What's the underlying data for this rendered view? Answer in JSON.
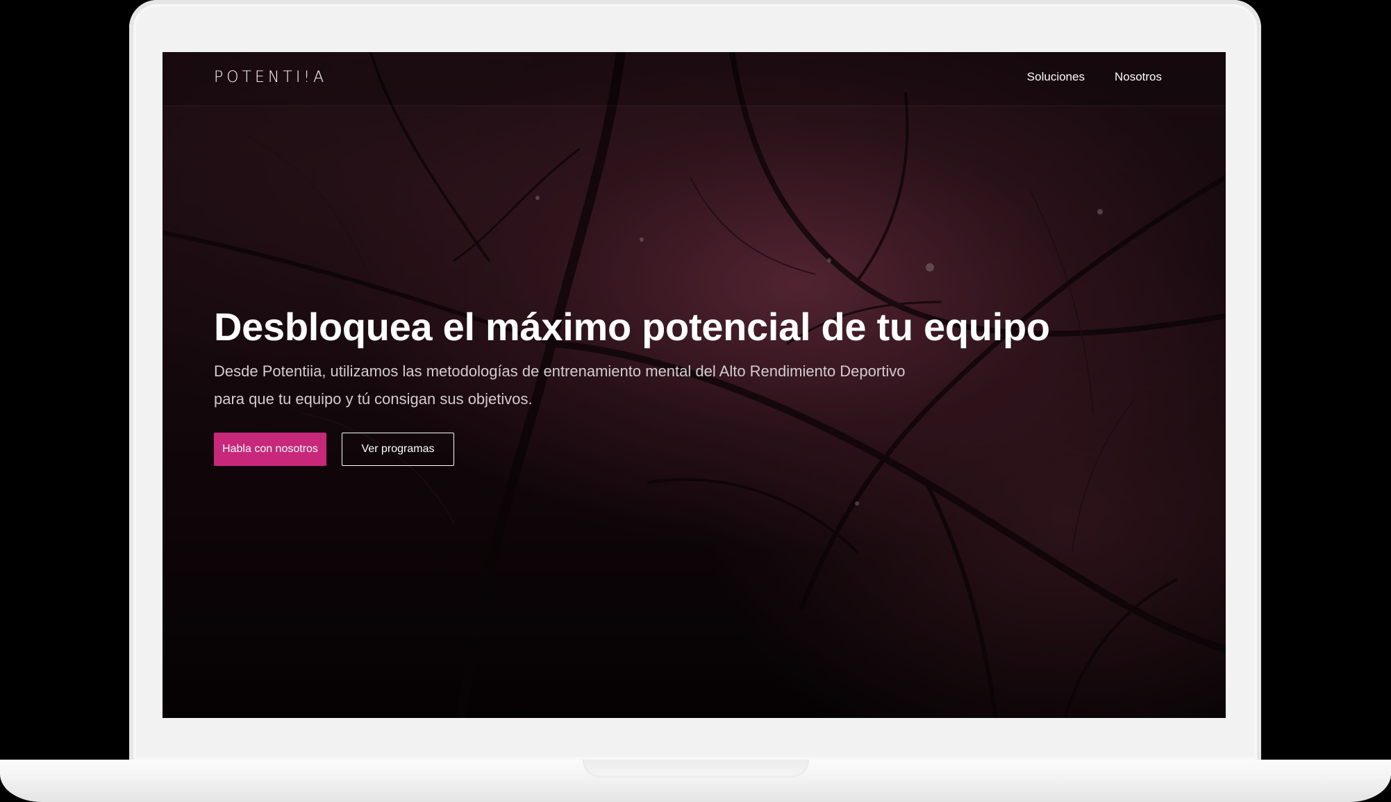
{
  "brand": {
    "logo_text": "POTENTI!A"
  },
  "nav": {
    "items": [
      {
        "label": "Soluciones"
      },
      {
        "label": "Nosotros"
      }
    ]
  },
  "hero": {
    "title": "Desbloquea el máximo potencial de tu equipo",
    "subtitle": "Desde Potentiia, utilizamos las metodologías de entrenamiento mental del Alto Rendimiento Deportivo para que tu equipo y tú consigan sus objetivos.",
    "primary_button": "Habla con nosotros",
    "secondary_button": "Ver programas"
  },
  "colors": {
    "accent": "#c7287a",
    "background_dark": "#12070b",
    "text": "#ffffff"
  }
}
